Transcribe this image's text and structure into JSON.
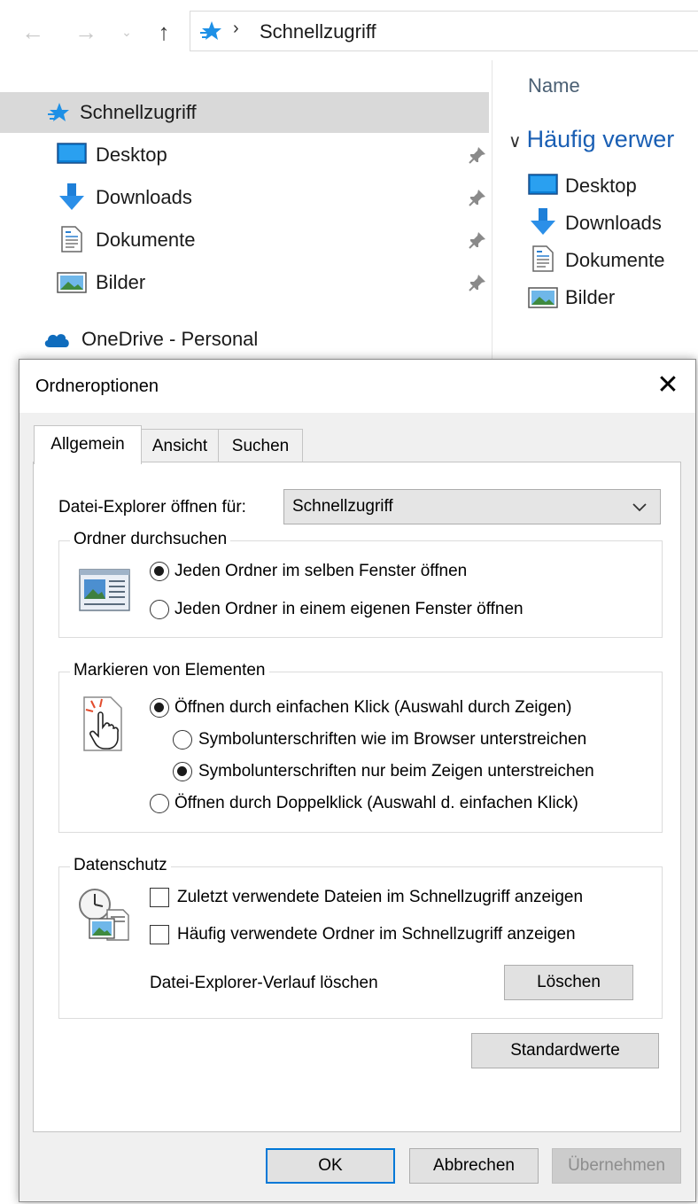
{
  "explorer": {
    "nav": {
      "back_icon": "back-arrow-icon",
      "forward_icon": "forward-arrow-icon",
      "recent_icon": "chevron-down-icon",
      "up_icon": "up-arrow-icon"
    },
    "address": {
      "separator": "›",
      "path": "Schnellzugriff"
    },
    "sidebar": {
      "items": [
        {
          "label": "Schnellzugriff",
          "icon": "quick-access-star-icon",
          "selected": true
        },
        {
          "label": "Desktop",
          "icon": "desktop-icon",
          "pinned": true
        },
        {
          "label": "Downloads",
          "icon": "downloads-icon",
          "pinned": true
        },
        {
          "label": "Dokumente",
          "icon": "documents-icon",
          "pinned": true
        },
        {
          "label": "Bilder",
          "icon": "pictures-icon",
          "pinned": true
        },
        {
          "label": "OneDrive - Personal",
          "icon": "onedrive-cloud-icon"
        }
      ]
    },
    "content": {
      "column_header": "Name",
      "group_header": "Häufig verwer",
      "items": [
        {
          "label": "Desktop",
          "icon": "desktop-icon"
        },
        {
          "label": "Downloads",
          "icon": "downloads-icon"
        },
        {
          "label": "Dokumente",
          "icon": "documents-icon"
        },
        {
          "label": "Bilder",
          "icon": "pictures-icon"
        }
      ]
    }
  },
  "dialog": {
    "title": "Ordneroptionen",
    "close_label": "✕",
    "tabs": [
      {
        "label": "Allgemein",
        "active": true
      },
      {
        "label": "Ansicht"
      },
      {
        "label": "Suchen"
      }
    ],
    "open_explorer": {
      "label": "Datei-Explorer öffnen für:",
      "value": "Schnellzugriff"
    },
    "browse_folders": {
      "legend": "Ordner durchsuchen",
      "options": [
        {
          "label": "Jeden Ordner im selben Fenster öffnen",
          "checked": true
        },
        {
          "label": "Jeden Ordner in einem eigenen Fenster öffnen",
          "checked": false
        }
      ]
    },
    "click_items": {
      "legend": "Markieren von Elementen",
      "options": [
        {
          "label": "Öffnen durch einfachen Klick (Auswahl durch Zeigen)",
          "checked": true
        },
        {
          "label": "Symbolunterschriften wie im Browser unterstreichen",
          "checked": false
        },
        {
          "label": "Symbolunterschriften nur beim Zeigen unterstreichen",
          "checked": true
        },
        {
          "label": "Öffnen durch Doppelklick (Auswahl d. einfachen Klick)",
          "checked": false
        }
      ]
    },
    "privacy": {
      "legend": "Datenschutz",
      "checkboxes": [
        {
          "label": "Zuletzt verwendete Dateien im Schnellzugriff anzeigen",
          "checked": false
        },
        {
          "label": "Häufig verwendete Ordner im Schnellzugriff anzeigen",
          "checked": false
        }
      ],
      "clear_history_label": "Datei-Explorer-Verlauf löschen",
      "clear_button": "Löschen"
    },
    "restore_defaults_button": "Standardwerte",
    "buttons": {
      "ok": "OK",
      "cancel": "Abbrechen",
      "apply": "Übernehmen"
    }
  }
}
